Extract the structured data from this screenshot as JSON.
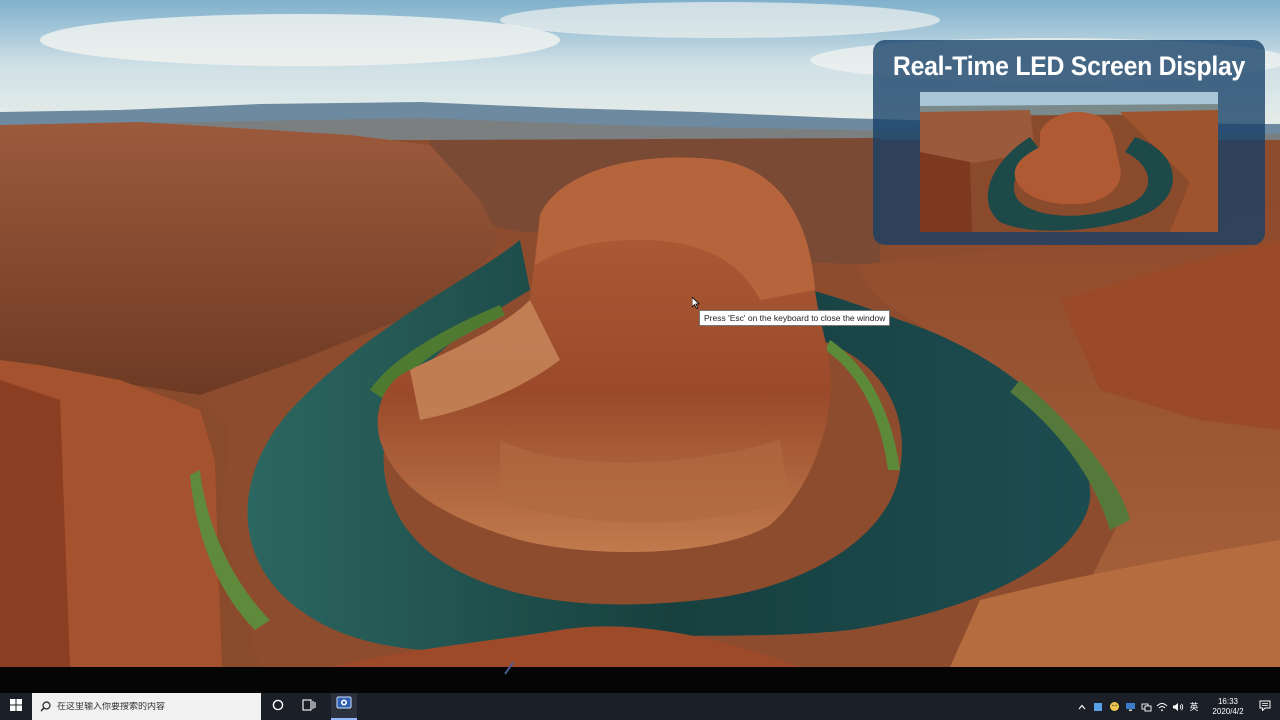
{
  "overlay": {
    "title": "Real-Time LED Screen Display"
  },
  "tooltip": {
    "text": "Press 'Esc' on the keyboard to close the window"
  },
  "taskbar": {
    "search_placeholder": "在这里输入你要搜索的内容",
    "ime_label": "英",
    "time": "16:33",
    "date": "2020/4/2",
    "app_icon": "led-display-app-icon"
  },
  "colors": {
    "taskbar_bg": "#1b1f27",
    "overlay_bg": "#164068",
    "rock": "#a4532e",
    "river": "#1f4a48"
  }
}
